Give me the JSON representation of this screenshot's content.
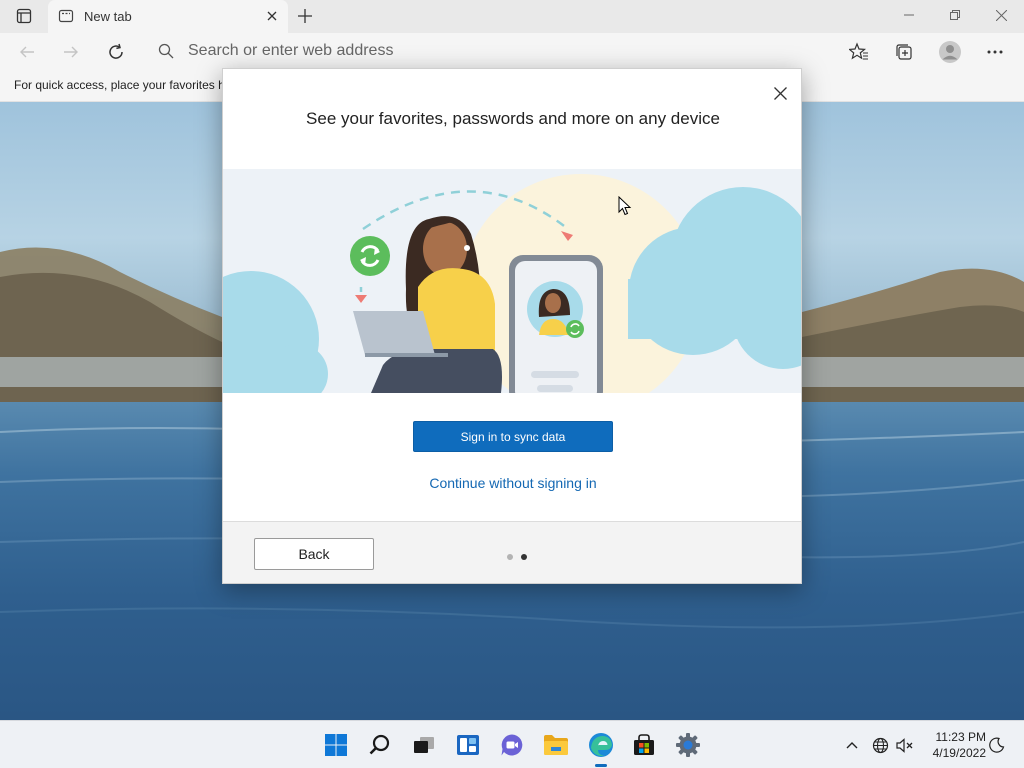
{
  "browser": {
    "tab": {
      "title": "New tab"
    },
    "address_bar": {
      "placeholder": "Search or enter web address"
    },
    "favorites_bar": {
      "text": "For quick access, place your favorites h"
    }
  },
  "dialog": {
    "title": "See your favorites, passwords and more on any device",
    "primary_button": "Sign in to sync data",
    "secondary_link": "Continue without signing in",
    "back_button": "Back",
    "steps": {
      "total": 2,
      "current": 2
    }
  },
  "taskbar": {
    "apps": [
      "start",
      "search",
      "task-view",
      "widgets",
      "chat",
      "file-explorer",
      "edge",
      "store",
      "settings"
    ],
    "active_app": "edge",
    "clock": {
      "time": "11:23 PM",
      "date": "4/19/2022"
    }
  },
  "colors": {
    "accent": "#0f6cbd",
    "link": "#1468b3",
    "sync_green": "#5cbd5c"
  }
}
